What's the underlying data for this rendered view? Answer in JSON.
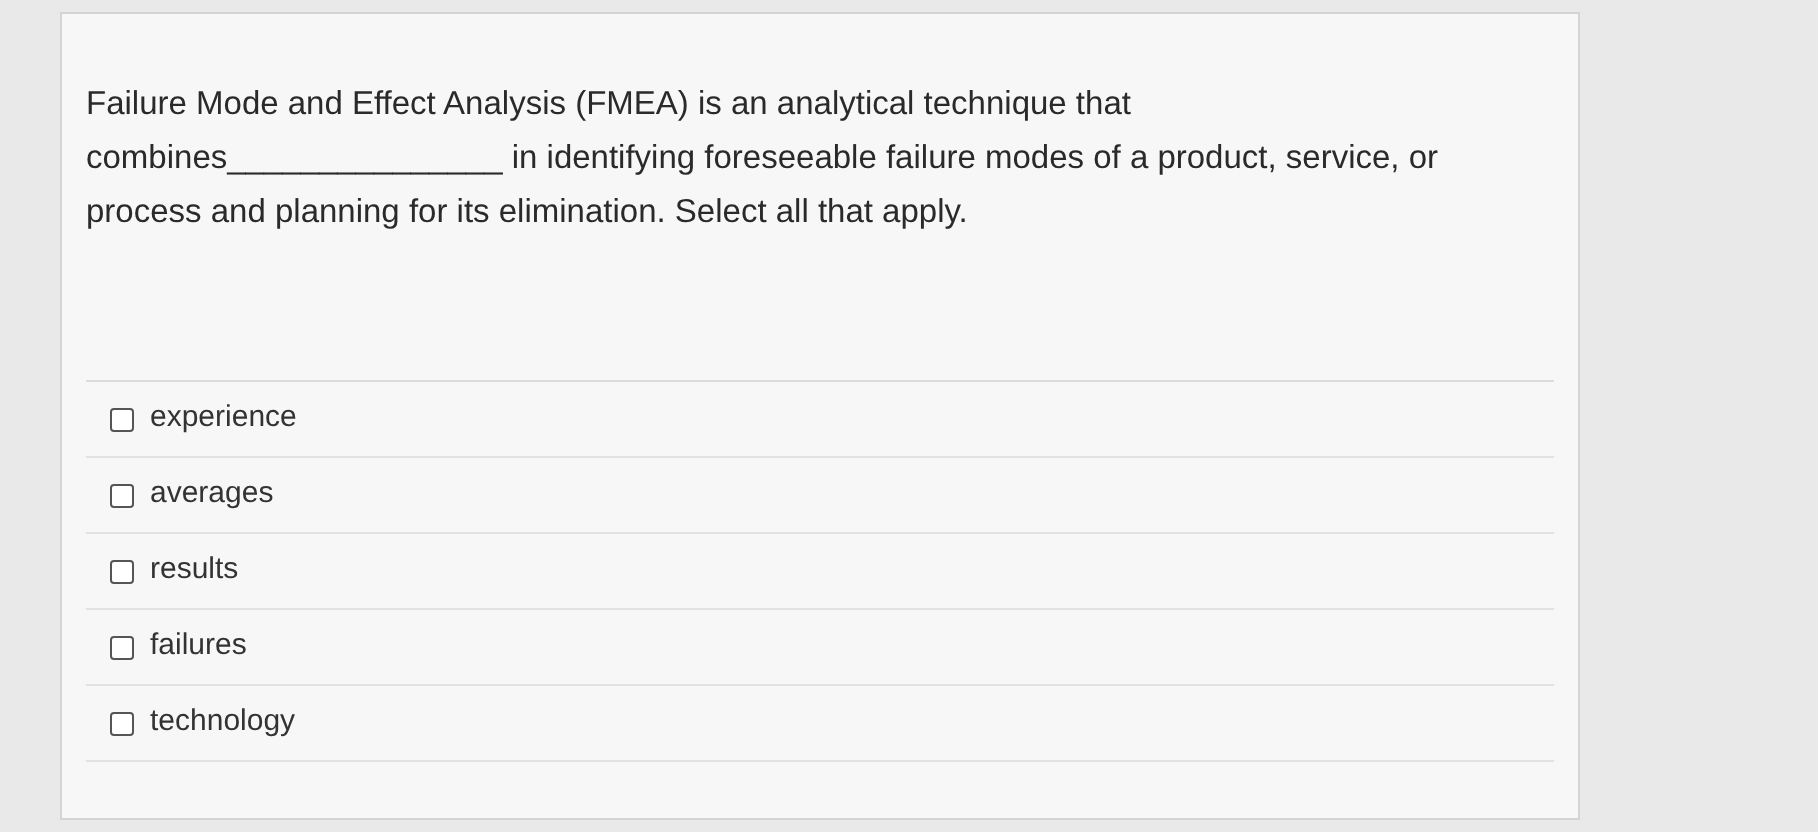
{
  "question": "Failure Mode and Effect Analysis (FMEA) is an analytical technique that combines_______________ in identifying foreseeable failure modes of a product, service, or process and planning for its elimination. Select all that apply.",
  "options": [
    {
      "label": "experience",
      "checked": false
    },
    {
      "label": "averages",
      "checked": false
    },
    {
      "label": "results",
      "checked": false
    },
    {
      "label": "failures",
      "checked": false
    },
    {
      "label": "technology",
      "checked": false
    }
  ]
}
